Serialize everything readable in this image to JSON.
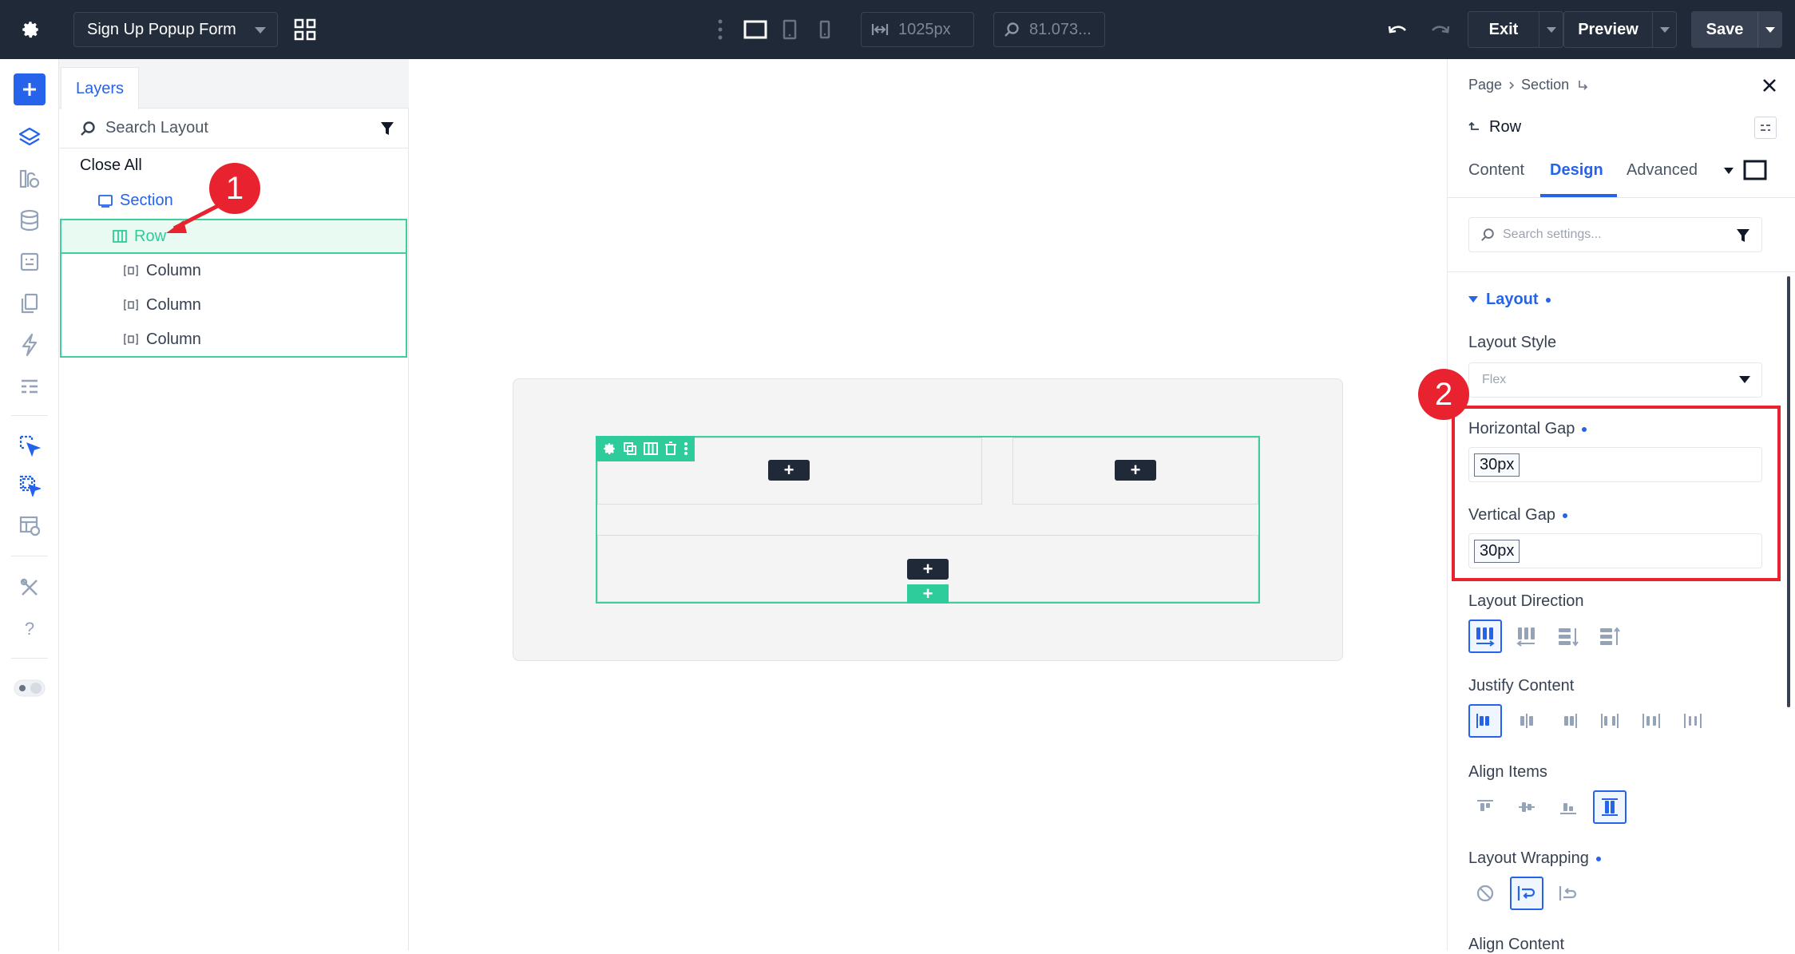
{
  "topbar": {
    "page_title": "Sign Up Popup Form",
    "width_value": "1025px",
    "zoom_value": "81.073...",
    "exit_label": "Exit",
    "preview_label": "Preview",
    "save_label": "Save"
  },
  "layers": {
    "tab_label": "Layers",
    "search_placeholder": "Search Layout",
    "close_all": "Close All",
    "tree": {
      "section": "Section",
      "row": "Row",
      "col1": "Column",
      "col2": "Column",
      "col3": "Column"
    }
  },
  "canvas": {
    "plus": "+"
  },
  "settings": {
    "breadcrumb": {
      "page": "Page",
      "section": "Section"
    },
    "element_title": "Row",
    "tabs": {
      "content": "Content",
      "design": "Design",
      "advanced": "Advanced"
    },
    "search_placeholder": "Search settings...",
    "group_title": "Layout",
    "layout_style": {
      "label": "Layout Style",
      "value": "Flex"
    },
    "horizontal_gap": {
      "label": "Horizontal Gap",
      "value": "30px"
    },
    "vertical_gap": {
      "label": "Vertical Gap",
      "value": "30px"
    },
    "layout_direction": {
      "label": "Layout Direction"
    },
    "justify_content": {
      "label": "Justify Content"
    },
    "align_items": {
      "label": "Align Items"
    },
    "layout_wrapping": {
      "label": "Layout Wrapping"
    },
    "align_content": {
      "label": "Align Content"
    }
  },
  "annotations": {
    "badge1": "1",
    "badge2": "2"
  },
  "colors": {
    "accent": "#2563eb",
    "green": "#2ecc9a",
    "dark": "#1f2937",
    "annotation_red": "#e8232f"
  }
}
